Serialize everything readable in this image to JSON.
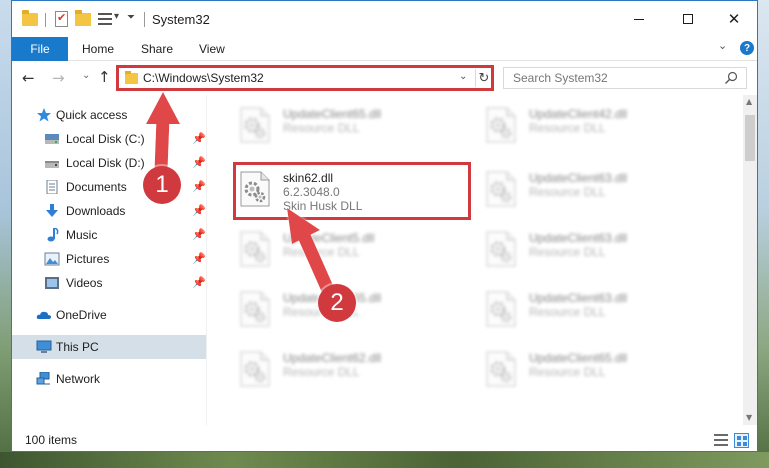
{
  "window": {
    "title": "System32",
    "minimize_label": "",
    "maximize_label": "",
    "close_glyph": "✕"
  },
  "ribbon": {
    "tabs": [
      {
        "label": "File"
      },
      {
        "label": "Home"
      },
      {
        "label": "Share"
      },
      {
        "label": "View"
      }
    ],
    "help_glyph": "?"
  },
  "nav": {
    "address": "C:\\Windows\\System32",
    "search_placeholder": "Search System32"
  },
  "sidebar": {
    "items": [
      {
        "label": "Quick access",
        "icon": "star-icon",
        "pinned": false
      },
      {
        "label": "Local Disk (C:)",
        "icon": "drive-icon",
        "pinned": true
      },
      {
        "label": "Local Disk (D:)",
        "icon": "drive-icon",
        "pinned": true
      },
      {
        "label": "Documents",
        "icon": "documents-icon",
        "pinned": true
      },
      {
        "label": "Downloads",
        "icon": "download-icon",
        "pinned": true
      },
      {
        "label": "Music",
        "icon": "music-icon",
        "pinned": true
      },
      {
        "label": "Pictures",
        "icon": "pictures-icon",
        "pinned": true
      },
      {
        "label": "Videos",
        "icon": "videos-icon",
        "pinned": true
      },
      {
        "label": "OneDrive",
        "icon": "cloud-icon",
        "pinned": false
      },
      {
        "label": "This PC",
        "icon": "computer-icon",
        "pinned": false,
        "selected": true
      },
      {
        "label": "Network",
        "icon": "network-icon",
        "pinned": false
      }
    ]
  },
  "files": [
    {
      "name": "UpdateClient65.dll",
      "type": "Resource DLL",
      "blurred": true
    },
    {
      "name": "UpdateClient42.dll",
      "type": "Resource DLL",
      "blurred": true
    },
    {
      "name": "skin62.dll",
      "version": "6.2.3048.0",
      "type": "Skin Husk DLL",
      "blurred": false
    },
    {
      "name": "UpdateClient63.dll",
      "type": "Resource DLL",
      "blurred": true
    },
    {
      "name": "UpdateClient5.dll",
      "type": "Resource DLL",
      "blurred": true
    },
    {
      "name": "UpdateClient63.dll",
      "type": "Resource DLL",
      "blurred": true
    },
    {
      "name": "UpdateClient65.dll",
      "type": "Resource DLL",
      "blurred": true
    },
    {
      "name": "UpdateClient63.dll",
      "type": "Resource DLL",
      "blurred": true
    },
    {
      "name": "UpdateClient62.dll",
      "type": "Resource DLL",
      "blurred": true
    },
    {
      "name": "UpdateClient65.dll",
      "type": "Resource DLL",
      "blurred": true
    }
  ],
  "status": {
    "item_count": "100 items"
  },
  "callouts": [
    {
      "number": "1"
    },
    {
      "number": "2"
    }
  ],
  "colors": {
    "accent": "#1979ca",
    "highlight": "#d0393d"
  }
}
